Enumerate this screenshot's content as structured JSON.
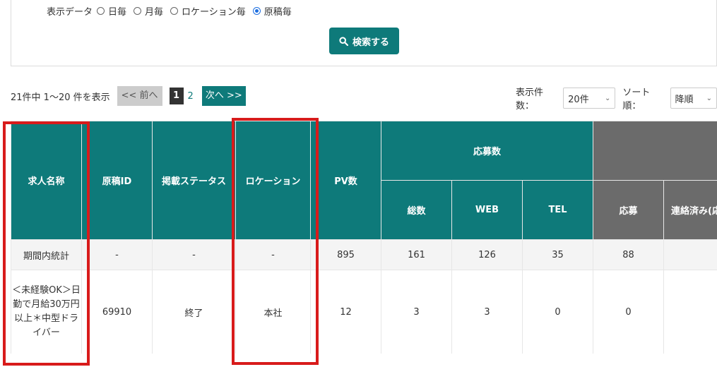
{
  "filter": {
    "label": "表示データ",
    "options": [
      {
        "label": "日毎",
        "selected": false
      },
      {
        "label": "月毎",
        "selected": false
      },
      {
        "label": "ロケーション毎",
        "selected": false
      },
      {
        "label": "原稿毎",
        "selected": true
      }
    ],
    "search_label": "検索する",
    "search_icon": "search-icon"
  },
  "pager": {
    "info": "21件中 1～20 件を表示",
    "prev": "<< 前へ",
    "current": "1",
    "page2": "2",
    "next": "次へ >>"
  },
  "controls": {
    "count_label": "表示件数：",
    "count_value": "20件",
    "sort_label": "ソート順：",
    "sort_value": "降順"
  },
  "table": {
    "headers": {
      "job_name": "求人名称",
      "draft_id": "原稿ID",
      "status": "掲載ステータス",
      "location": "ロケーション",
      "pv": "PV数",
      "applications": "応募数",
      "total": "総数",
      "web": "WEB",
      "tel": "TEL",
      "apply": "応募",
      "contacted": "連絡済み(応"
    },
    "stats": {
      "label": "期間内統計",
      "draft_id": "-",
      "status": "-",
      "location": "-",
      "pv": "895",
      "total": "161",
      "web": "126",
      "tel": "35",
      "apply": "88",
      "contacted": ""
    },
    "rows": [
      {
        "job_name": "＜未経験OK＞日勤で月給30万円以上＊中型ドライバー",
        "draft_id": "69910",
        "status": "終了",
        "location": "本社",
        "pv": "12",
        "total": "3",
        "web": "3",
        "tel": "0",
        "apply": "0",
        "contacted": ""
      }
    ]
  },
  "colors": {
    "accent": "#0e7a7a",
    "gray_header": "#6b6b6b",
    "highlight": "#d81b1b",
    "radio_selected": "#1e6fe0"
  }
}
